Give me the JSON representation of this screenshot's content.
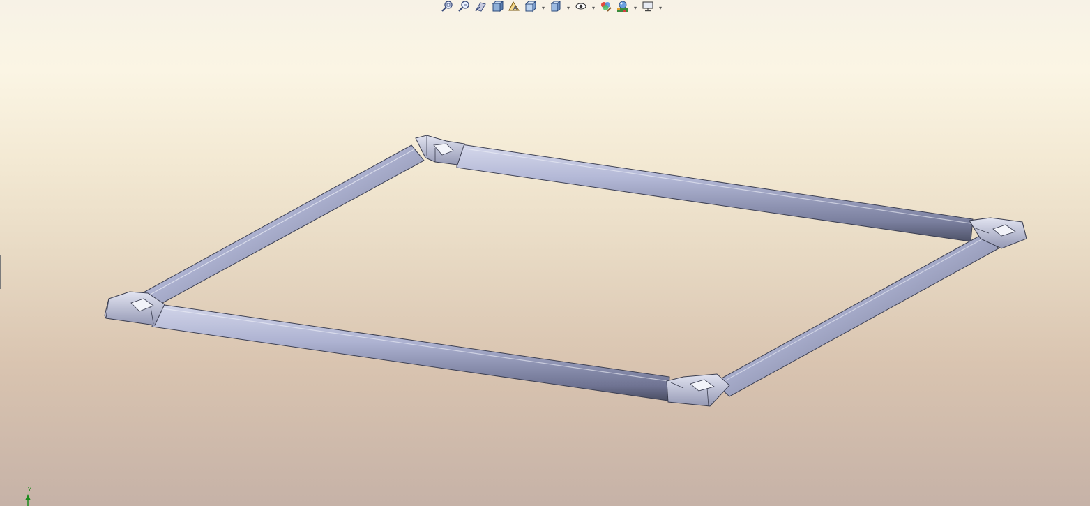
{
  "viewport": {
    "background_top": "#f7f2e6",
    "background_bottom": "#c6b2a7"
  },
  "toolbar": {
    "buttons": [
      {
        "icon": "zoom-to-fit-icon",
        "has_dropdown": false
      },
      {
        "icon": "zoom-to-area-icon",
        "has_dropdown": false
      },
      {
        "icon": "previous-view-icon",
        "has_dropdown": false
      },
      {
        "icon": "section-view-icon",
        "has_dropdown": false
      },
      {
        "icon": "dynamic-annotation-views-icon",
        "has_dropdown": false
      },
      {
        "icon": "view-orientation-icon",
        "has_dropdown": true
      },
      {
        "icon": "display-style-icon",
        "has_dropdown": true
      },
      {
        "icon": "hide-show-items-icon",
        "has_dropdown": true
      },
      {
        "icon": "edit-appearance-icon",
        "has_dropdown": false
      },
      {
        "icon": "apply-scene-icon",
        "has_dropdown": true
      },
      {
        "icon": "view-settings-icon",
        "has_dropdown": true
      }
    ]
  },
  "model": {
    "tube_color": "#aeb3d3",
    "tube_shadow": "#5c6078",
    "joint_color": "#c3c6dc"
  },
  "triad": {
    "axis_label": "Y",
    "axis_color": "#1b8a1b"
  }
}
